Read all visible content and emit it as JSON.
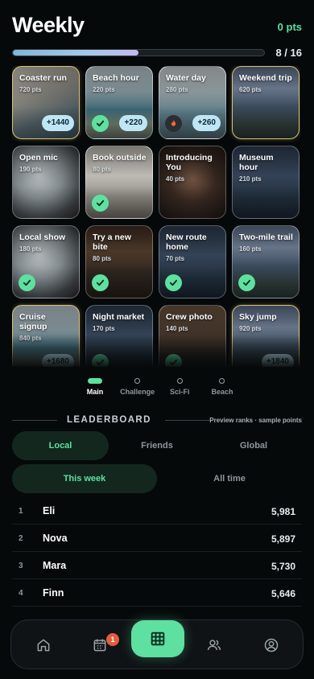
{
  "header": {
    "title": "Weekly",
    "points": "0 pts"
  },
  "progress": {
    "count": "8 / 16",
    "fraction": 0.5
  },
  "challenges": [
    {
      "title": "Coaster run",
      "pts": "720 pts",
      "bg": "amuse",
      "done": false,
      "bonus": "+1440",
      "featured": true
    },
    {
      "title": "Beach hour",
      "pts": "220 pts",
      "bg": "beach",
      "done": true,
      "bonus": "+220",
      "featured": false
    },
    {
      "title": "Water day",
      "pts": "280 pts",
      "bg": "water",
      "done": false,
      "flame": true,
      "bonus": "+260",
      "featured": false
    },
    {
      "title": "Weekend trip",
      "pts": "620 pts",
      "bg": "mount",
      "done": false,
      "bonus": "",
      "featured": true
    },
    {
      "title": "Open mic",
      "pts": "190 pts",
      "bg": "mic",
      "done": false,
      "bonus": "",
      "featured": false
    },
    {
      "title": "Book outside",
      "pts": "80 pts",
      "bg": "book",
      "done": true,
      "bonus": "",
      "featured": false
    },
    {
      "title": "Introducing You",
      "pts": "40 pts",
      "bg": "person",
      "done": false,
      "bonus": "",
      "featured": false
    },
    {
      "title": "Museum hour",
      "pts": "210 pts",
      "bg": "city",
      "done": false,
      "bonus": "",
      "featured": false
    },
    {
      "title": "Local show",
      "pts": "180 pts",
      "bg": "mic",
      "done": true,
      "bonus": "",
      "featured": false
    },
    {
      "title": "Try a new bite",
      "pts": "80 pts",
      "bg": "restaurant",
      "done": true,
      "bonus": "",
      "featured": false
    },
    {
      "title": "New route home",
      "pts": "70 pts",
      "bg": "city",
      "done": true,
      "bonus": "",
      "featured": false
    },
    {
      "title": "Two-mile trail",
      "pts": "160 pts",
      "bg": "mount",
      "done": true,
      "bonus": "",
      "featured": false
    },
    {
      "title": "Cruise signup",
      "pts": "840 pts",
      "bg": "beach",
      "done": false,
      "bonus": "+1680",
      "featured": true
    },
    {
      "title": "Night market",
      "pts": "170 pts",
      "bg": "city",
      "done": true,
      "bonus": "",
      "featured": false
    },
    {
      "title": "Crew photo",
      "pts": "140 pts",
      "bg": "crew",
      "done": true,
      "bonus": "",
      "featured": false
    },
    {
      "title": "Sky jump",
      "pts": "920 pts",
      "bg": "mount",
      "done": false,
      "bonus": "+1840",
      "featured": true
    }
  ],
  "modes": [
    {
      "label": "Main",
      "active": true
    },
    {
      "label": "Challenge",
      "active": false
    },
    {
      "label": "Sci-Fi",
      "active": false
    },
    {
      "label": "Beach",
      "active": false
    }
  ],
  "leaderboard": {
    "title": "LEADERBOARD",
    "note": "Preview ranks · sample points",
    "scopes": [
      "Local",
      "Friends",
      "Global"
    ],
    "periods": [
      "This week",
      "All time"
    ],
    "rows": [
      {
        "rank": "1",
        "name": "Eli",
        "score": "5,981"
      },
      {
        "rank": "2",
        "name": "Nova",
        "score": "5,897"
      },
      {
        "rank": "3",
        "name": "Mara",
        "score": "5,730"
      },
      {
        "rank": "4",
        "name": "Finn",
        "score": "5,646"
      }
    ]
  },
  "nav": {
    "calendar_badge": "1",
    "items": [
      "home-icon",
      "calendar-icon",
      "grid-icon",
      "people-icon",
      "profile-icon"
    ]
  },
  "colors": {
    "accent": "#5ee0a0",
    "bonus_pill": "#bfe6f5",
    "featured_border": "#d9c27a"
  }
}
